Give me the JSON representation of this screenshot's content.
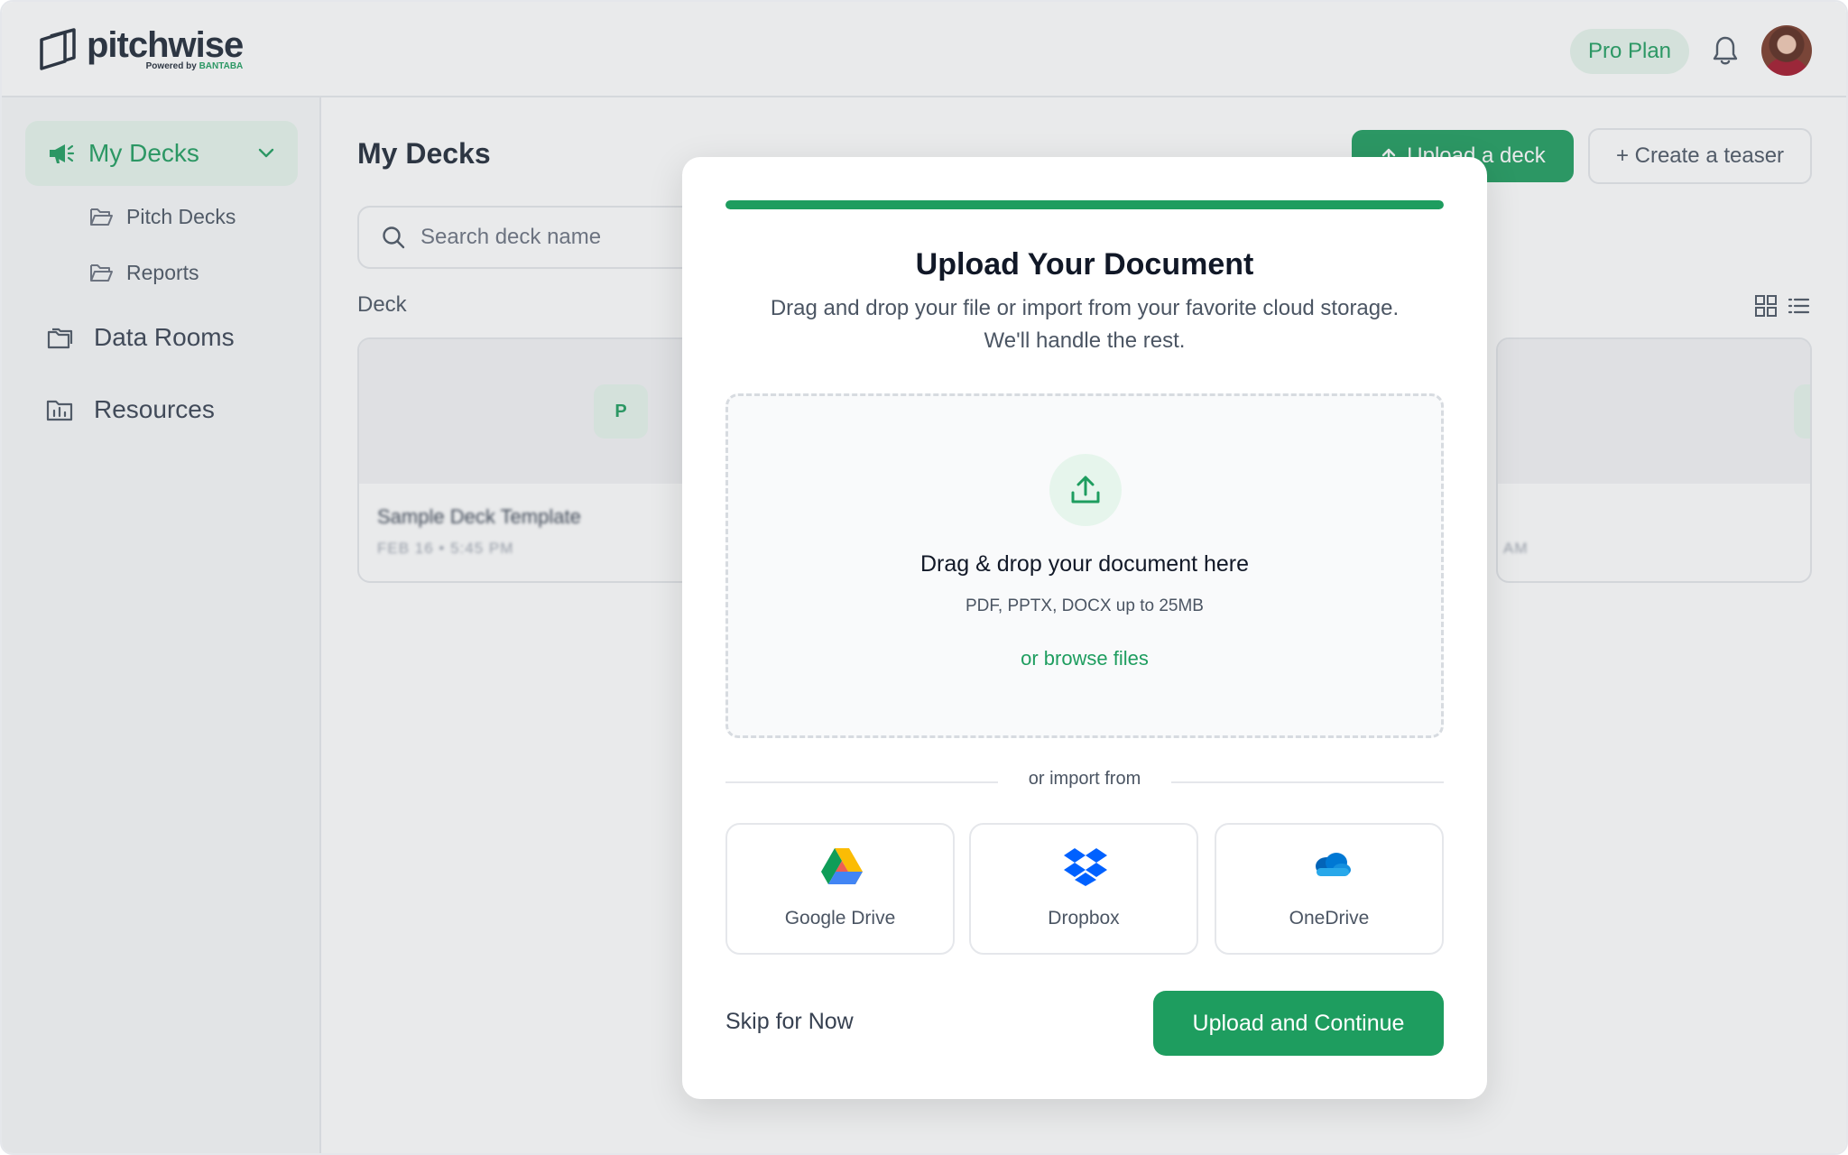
{
  "brand": {
    "name": "pitchwise",
    "powered_prefix": "Powered by",
    "powered_brand": "BANTABA"
  },
  "header": {
    "plan_badge": "Pro Plan",
    "bell_icon": "bell-icon",
    "avatar": "user-avatar"
  },
  "sidebar": {
    "active": {
      "label": "My Decks",
      "icon": "megaphone-icon"
    },
    "subitems": [
      {
        "label": "Pitch Decks",
        "icon": "folder-open-icon"
      },
      {
        "label": "Reports",
        "icon": "folder-open-icon"
      }
    ],
    "items": [
      {
        "label": "Data Rooms",
        "icon": "folders-icon"
      },
      {
        "label": "Resources",
        "icon": "chart-folder-icon"
      }
    ]
  },
  "main": {
    "title": "My Decks",
    "upload_button": "Upload a deck",
    "teaser_button": "+ Create a teaser",
    "search_placeholder": "Search deck name",
    "section_label": "Deck",
    "cards": [
      {
        "badge": "P",
        "title": "Sample Deck Template",
        "date": "FEB 16 • 5:45 PM"
      },
      {
        "badge": "P",
        "title": "",
        "date": "AM"
      }
    ]
  },
  "modal": {
    "progress": 1.0,
    "title": "Upload Your Document",
    "subtitle_line1": "Drag and drop your file or import from your favorite cloud storage.",
    "subtitle_line2": "We'll handle the rest.",
    "dropzone": {
      "title": "Drag & drop your document here",
      "hint": "PDF, PPTX, DOCX up to 25MB",
      "browse": "or browse files"
    },
    "divider": "or import from",
    "imports": [
      {
        "label": "Google Drive",
        "icon": "google-drive-icon"
      },
      {
        "label": "Dropbox",
        "icon": "dropbox-icon"
      },
      {
        "label": "OneDrive",
        "icon": "onedrive-icon"
      }
    ],
    "skip": "Skip for Now",
    "continue": "Upload and Continue"
  },
  "colors": {
    "accent": "#1e9d5f",
    "accent_soft": "#e6f5ec",
    "border": "#e5e7eb"
  }
}
